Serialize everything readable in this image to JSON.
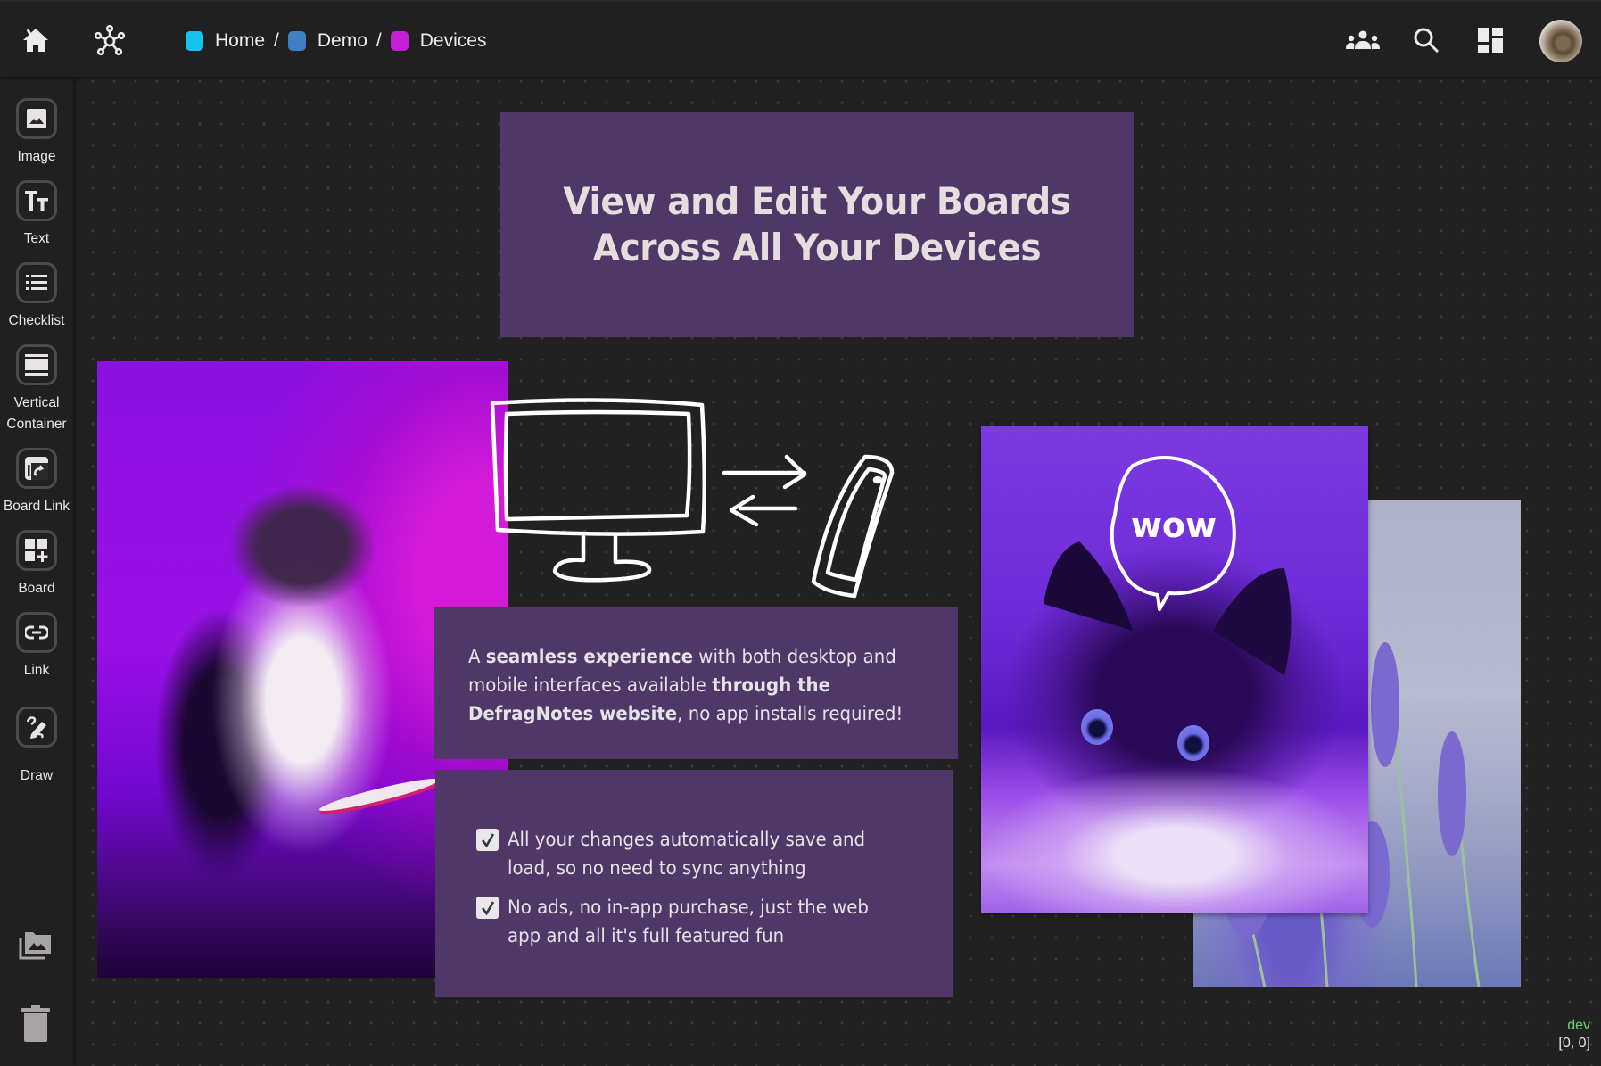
{
  "topbar": {
    "home_icon": "home-icon",
    "graph_icon": "graph-network-icon",
    "breadcrumb": [
      {
        "label": "Home",
        "color": "#13c3ec"
      },
      {
        "label": "Demo",
        "color": "#3f7fc6"
      },
      {
        "label": "Devices",
        "color": "#c41fd6"
      }
    ],
    "separator": "/",
    "right_icons": [
      "people-icon",
      "search-icon",
      "dashboard-layout-icon"
    ],
    "avatar_alt": "user-avatar"
  },
  "sidebar": {
    "tools": [
      {
        "label": "Image",
        "icon": "image-icon"
      },
      {
        "label": "Text",
        "icon": "text-icon"
      },
      {
        "label": "Checklist",
        "icon": "checklist-icon"
      },
      {
        "label": "Vertical Container",
        "icon": "vertical-container-icon"
      },
      {
        "label": "Board Link",
        "icon": "board-link-icon"
      },
      {
        "label": "Board",
        "icon": "board-add-icon"
      },
      {
        "label": "Link",
        "icon": "link-icon"
      },
      {
        "label": "Draw",
        "icon": "draw-icon"
      }
    ],
    "bottom": [
      "image-library-icon",
      "trash-icon"
    ]
  },
  "canvas": {
    "title_card": {
      "text": "View and Edit Your Boards\nAcross All Your Devices",
      "bg": "#4f3868"
    },
    "description_card": {
      "segments": [
        {
          "text": "A ",
          "bold": false
        },
        {
          "text": "seamless experience",
          "bold": true
        },
        {
          "text": " with both desktop and mobile interfaces available ",
          "bold": false
        },
        {
          "text": "through the DefragNotes website",
          "bold": true
        },
        {
          "text": ", no app installs required!",
          "bold": false
        }
      ]
    },
    "checklist_card": {
      "items": [
        {
          "text": "All your changes automatically save and load, so no need to sync anything",
          "checked": true
        },
        {
          "text": "No ads, no in-app purchase, just the web app and all it's full featured fun",
          "checked": true
        }
      ]
    },
    "drawing_speech_bubble_text": "wow",
    "images": [
      "cat-photo-purple",
      "cat-photo-wow",
      "lavender-photo"
    ]
  },
  "status": {
    "env": "dev",
    "coords": "[0, 0]"
  }
}
